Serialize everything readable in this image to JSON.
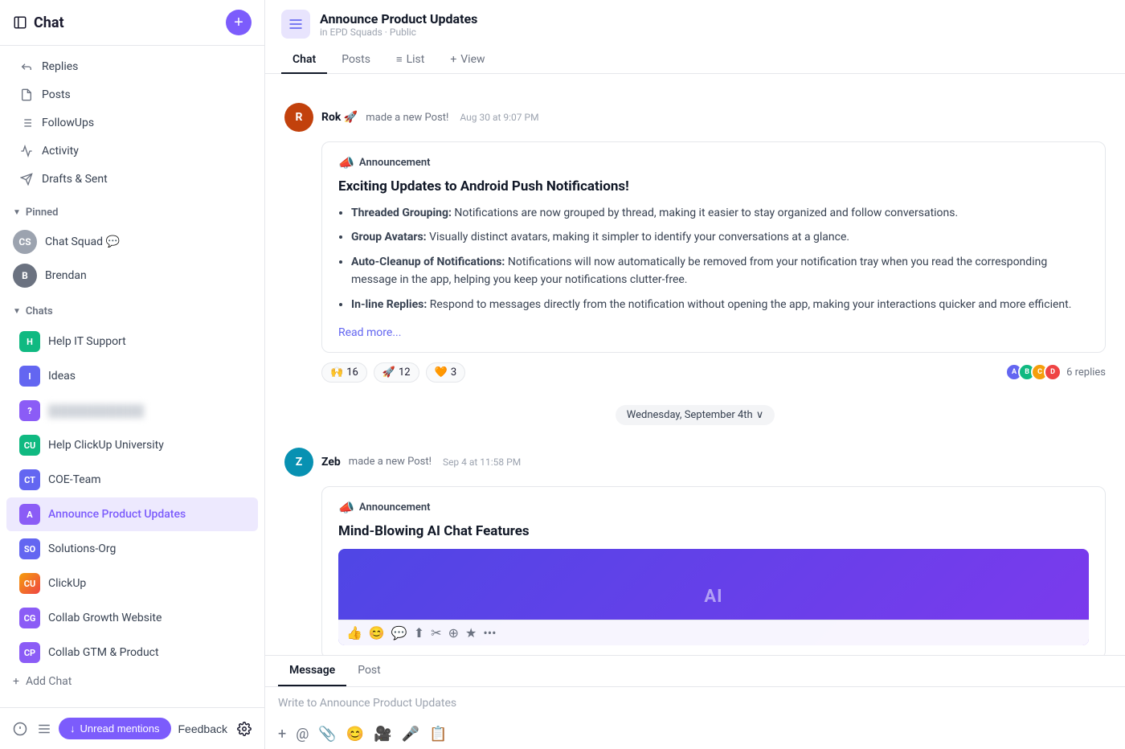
{
  "sidebar": {
    "title": "Chat",
    "add_button_label": "+",
    "nav_items": [
      {
        "id": "replies",
        "label": "Replies",
        "icon": "reply"
      },
      {
        "id": "posts",
        "label": "Posts",
        "icon": "post"
      },
      {
        "id": "followups",
        "label": "FollowUps",
        "icon": "followup"
      },
      {
        "id": "activity",
        "label": "Activity",
        "icon": "activity"
      },
      {
        "id": "drafts",
        "label": "Drafts & Sent",
        "icon": "draft"
      }
    ],
    "pinned_section": "Pinned",
    "pinned_items": [
      {
        "id": "chat-squad",
        "label": "Chat Squad",
        "avatar_color": "#9ca3af",
        "avatar_text": "CS",
        "badge": "💬"
      },
      {
        "id": "brendan",
        "label": "Brendan",
        "avatar_color": "#6b7280",
        "avatar_text": "B"
      }
    ],
    "chats_section": "Chats",
    "chat_items": [
      {
        "id": "help-it",
        "label": "Help IT Support",
        "avatar_color": "#10b981",
        "avatar_text": "H",
        "active": false
      },
      {
        "id": "ideas",
        "label": "Ideas",
        "avatar_color": "#6366f1",
        "avatar_text": "I",
        "active": false
      },
      {
        "id": "blurred",
        "label": "██████ ████████",
        "avatar_color": "#8b5cf6",
        "avatar_text": "?",
        "active": false
      },
      {
        "id": "clickup-uni",
        "label": "Help ClickUp University",
        "avatar_color": "#10b981",
        "avatar_text": "C",
        "active": false
      },
      {
        "id": "coe-team",
        "label": "COE-Team",
        "avatar_color": "#6366f1",
        "avatar_text": "CT",
        "active": false
      },
      {
        "id": "announce",
        "label": "Announce Product Updates",
        "avatar_color": "#8b5cf6",
        "avatar_text": "A",
        "active": true
      },
      {
        "id": "solutions-org",
        "label": "Solutions-Org",
        "avatar_color": "#6366f1",
        "avatar_text": "SO",
        "active": false
      },
      {
        "id": "clickup",
        "label": "ClickUp",
        "avatar_color": "#ef4444",
        "avatar_text": "CU",
        "active": false
      },
      {
        "id": "collab-growth",
        "label": "Collab Growth Website",
        "avatar_color": "#8b5cf6",
        "avatar_text": "CG",
        "active": false
      },
      {
        "id": "collab-gtm",
        "label": "Collab GTM & Product",
        "avatar_color": "#8b5cf6",
        "avatar_text": "CP",
        "active": false
      }
    ],
    "add_chat_label": "Add Chat",
    "unread_mentions_label": "Unread mentions",
    "feedback_label": "Feedback"
  },
  "main": {
    "channel": {
      "name": "Announce Product Updates",
      "subtitle": "in EPD Squads · Public"
    },
    "tabs": [
      {
        "id": "chat",
        "label": "Chat",
        "active": true
      },
      {
        "id": "posts",
        "label": "Posts",
        "active": false
      },
      {
        "id": "list",
        "label": "List",
        "active": false,
        "icon": "≡"
      },
      {
        "id": "view",
        "label": "View",
        "active": false,
        "prefix": "+"
      }
    ],
    "messages": [
      {
        "id": "msg1",
        "author": "Rok 🚀",
        "author_initials": "R",
        "author_color": "#c2410c",
        "action": "made a new Post!",
        "time": "Aug 30 at 9:07 PM",
        "post_type": "Announcement",
        "post_title": "Exciting Updates to Android Push Notifications!",
        "post_bullets": [
          {
            "bold": "Threaded Grouping:",
            "text": " Notifications are now grouped by thread, making it easier to stay organized and follow conversations."
          },
          {
            "bold": "Group Avatars:",
            "text": " Visually distinct avatars, making it simpler to identify your conversations at a glance."
          },
          {
            "bold": "Auto-Cleanup of Notifications:",
            "text": " Notifications will now automatically be removed from your notification tray when you read the corresponding message in the app, helping you keep your notifications clutter-free."
          },
          {
            "bold": "In-line Replies:",
            "text": " Respond to messages directly from the notification without opening the app, making your interactions quicker and more efficient."
          }
        ],
        "read_more": "Read more...",
        "reactions": [
          {
            "emoji": "🙌",
            "count": "16"
          },
          {
            "emoji": "🚀",
            "count": "12"
          },
          {
            "emoji": "🧡",
            "count": "3"
          }
        ],
        "replies": {
          "count": "6 replies",
          "avatars": [
            "#6366f1",
            "#10b981",
            "#f59e0b",
            "#ef4444"
          ]
        }
      },
      {
        "id": "msg2",
        "author": "Zeb",
        "author_initials": "Z",
        "author_color": "#0891b2",
        "action": "made a new Post!",
        "time": "Sep 4 at 11:58 PM",
        "post_type": "Announcement",
        "post_title": "Mind-Blowing AI Chat Features",
        "has_image": true
      }
    ],
    "date_divider": "Wednesday, September 4th",
    "input": {
      "tabs": [
        {
          "label": "Message",
          "active": true
        },
        {
          "label": "Post",
          "active": false
        }
      ],
      "placeholder": "Write to Announce Product Updates",
      "tools": [
        "+",
        "@",
        "📎",
        "😊",
        "🎥",
        "🎤",
        "📋"
      ]
    }
  }
}
